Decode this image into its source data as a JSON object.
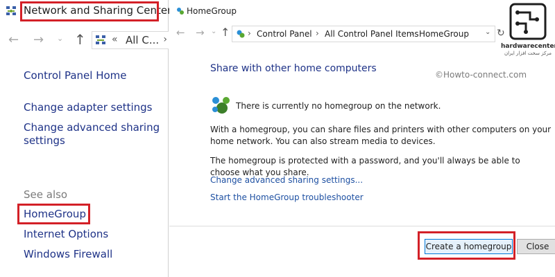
{
  "left_window": {
    "title": "Network and Sharing Center",
    "address_text": "All C...",
    "links": {
      "control_panel_home": "Control Panel Home",
      "change_adapter": "Change adapter settings",
      "change_advanced_line1": "Change advanced sharing",
      "change_advanced_line2": "settings",
      "see_also": "See also",
      "homegroup": "HomeGroup",
      "internet_options": "Internet Options",
      "windows_firewall": "Windows Firewall"
    }
  },
  "right_window": {
    "title": "HomeGroup",
    "breadcrumb": [
      "Control Panel",
      "All Control Panel Items",
      "HomeGroup"
    ],
    "heading": "Share with other home computers",
    "watermark": "©Howto-connect.com",
    "status": "There is currently no homegroup on the network.",
    "para1": "With a homegroup, you can share files and printers with other computers on your home network. You can also stream media to devices.",
    "para2": "The homegroup is protected with a password, and you'll always be able to choose what you share.",
    "link_advanced": "Change advanced sharing settings...",
    "link_troubleshooter": "Start the HomeGroup troubleshooter",
    "btn_create": "Create a homegroup",
    "btn_close": "Close"
  },
  "logo": {
    "name": "hardwarecenter.ir",
    "subtitle": "مرکز سخت افزار ایران"
  },
  "colors": {
    "highlight_red": "#d32027",
    "link_blue": "#1e3287",
    "primary_button": "#0078d7"
  }
}
